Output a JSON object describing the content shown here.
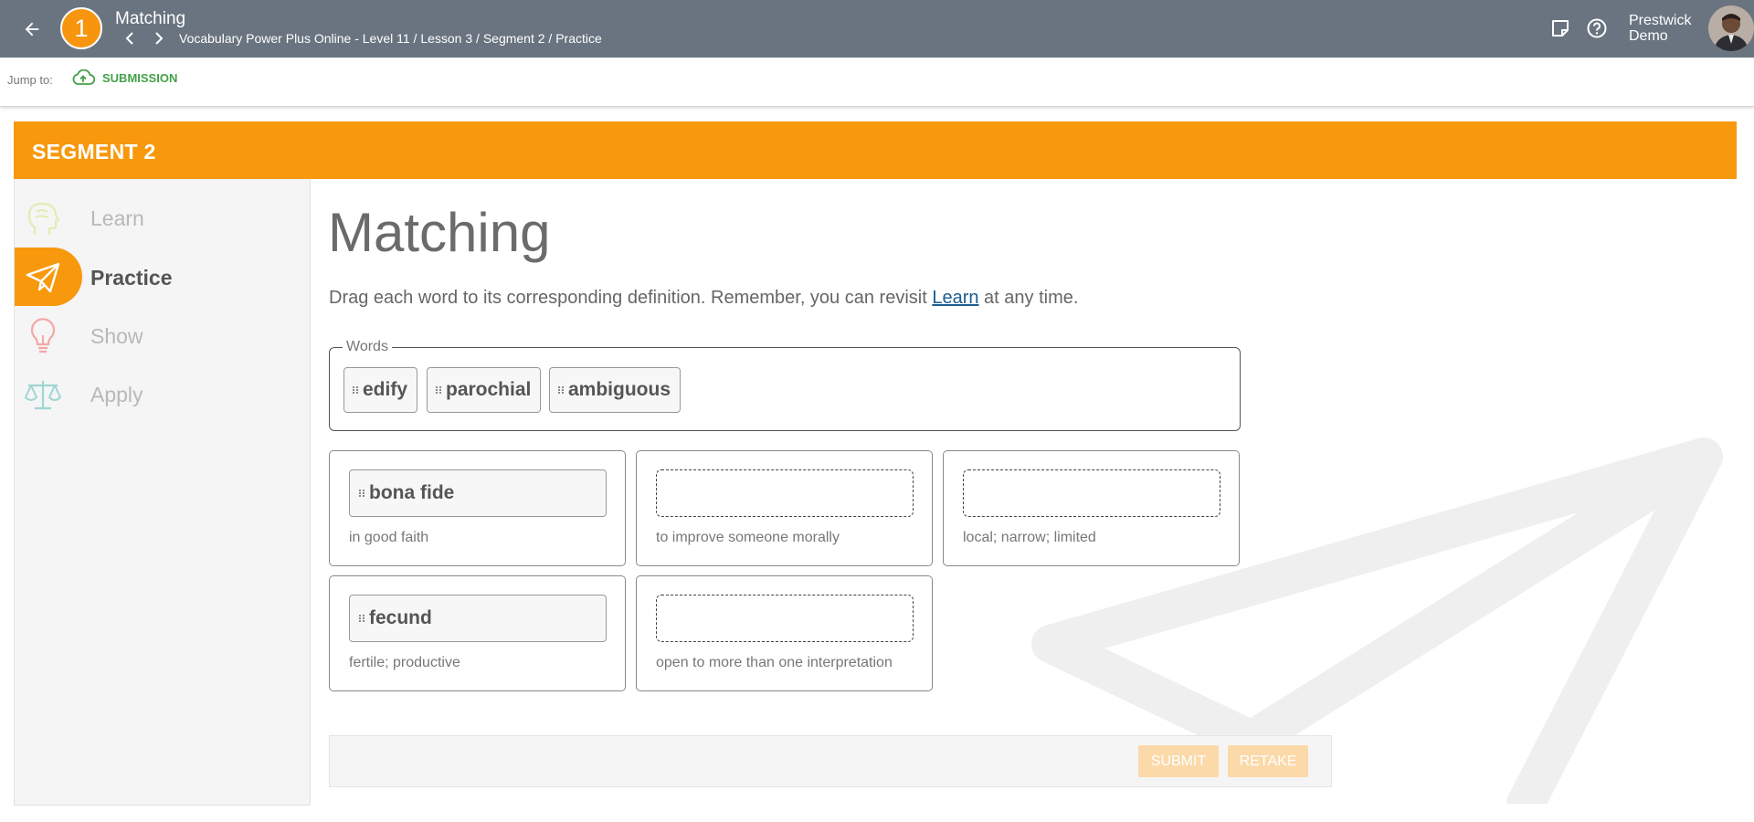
{
  "header": {
    "step_number": "1",
    "title": "Matching",
    "breadcrumb": "Vocabulary Power Plus Online - Level 11 / Lesson 3 / Segment 2 / Practice",
    "user_line1": "Prestwick",
    "user_line2": "Demo"
  },
  "jumpbar": {
    "label": "Jump to:",
    "link": "SUBMISSION"
  },
  "segment": {
    "title": "SEGMENT 2"
  },
  "sidebar": {
    "items": [
      {
        "label": "Learn",
        "icon": "brain-icon",
        "active": false
      },
      {
        "label": "Practice",
        "icon": "paper-plane-icon",
        "active": true
      },
      {
        "label": "Show",
        "icon": "lightbulb-icon",
        "active": false
      },
      {
        "label": "Apply",
        "icon": "scale-icon",
        "active": false
      }
    ]
  },
  "main": {
    "heading": "Matching",
    "instructions_pre": "Drag each word to its corresponding definition. Remember, you can revisit ",
    "instructions_link": "Learn",
    "instructions_post": " at any time.",
    "words_legend": "Words",
    "words": [
      "edify",
      "parochial",
      "ambiguous"
    ],
    "definitions": [
      {
        "word": "bona fide",
        "definition": "in good faith"
      },
      {
        "word": "",
        "definition": "to improve someone morally"
      },
      {
        "word": "",
        "definition": "local; narrow; limited"
      },
      {
        "word": "fecund",
        "definition": "fertile; productive"
      },
      {
        "word": "",
        "definition": "open to more than one interpretation"
      }
    ]
  },
  "actions": {
    "submit": "SUBMIT",
    "retake": "RETAKE"
  },
  "colors": {
    "topbar": "#697480",
    "accent": "#f8980d",
    "link_green": "#43a047"
  }
}
